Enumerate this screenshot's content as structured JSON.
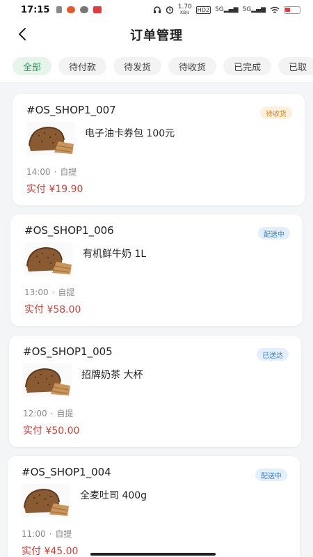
{
  "status": {
    "time": "17:15",
    "speed": "1.70",
    "speed_unit": "KB/s",
    "hd": "HD2",
    "net1": "5G",
    "net2": "5G"
  },
  "header": {
    "title": "订单管理"
  },
  "tabs": [
    {
      "label": "全部",
      "active": true
    },
    {
      "label": "待付款"
    },
    {
      "label": "待发货"
    },
    {
      "label": "待收货"
    },
    {
      "label": "已完成"
    },
    {
      "label": "已取"
    }
  ],
  "orders": [
    {
      "order_no": "#OS_SHOP1_007",
      "status": "待收货",
      "status_color": "orange",
      "product": "电子油卡券包 100元",
      "time": "14:00",
      "method": "自提",
      "price": "实付 ¥19.90"
    },
    {
      "order_no": "#OS_SHOP1_006",
      "status": "配送中",
      "status_color": "blue",
      "product": "有机鲜牛奶 1L",
      "time": "13:00",
      "method": "自提",
      "price": "实付 ¥58.00"
    },
    {
      "order_no": "#OS_SHOP1_005",
      "status": "已送达",
      "status_color": "blue",
      "product": "招牌奶茶 大杯",
      "time": "12:00",
      "method": "自提",
      "price": "实付 ¥50.00"
    },
    {
      "order_no": "#OS_SHOP1_004",
      "status": "配送中",
      "status_color": "blue",
      "product": "全麦吐司 400g",
      "time": "11:00",
      "method": "自提",
      "price": "实付 ¥45.00"
    }
  ],
  "meta_separator": "·",
  "colors": {
    "accent": "#2a9a5d",
    "price": "#c0433a",
    "badge_orange": "#d48a1d",
    "badge_blue": "#3a82c4"
  },
  "icons": {
    "back": "chevron-left-icon",
    "thumb": "bread-icon"
  }
}
